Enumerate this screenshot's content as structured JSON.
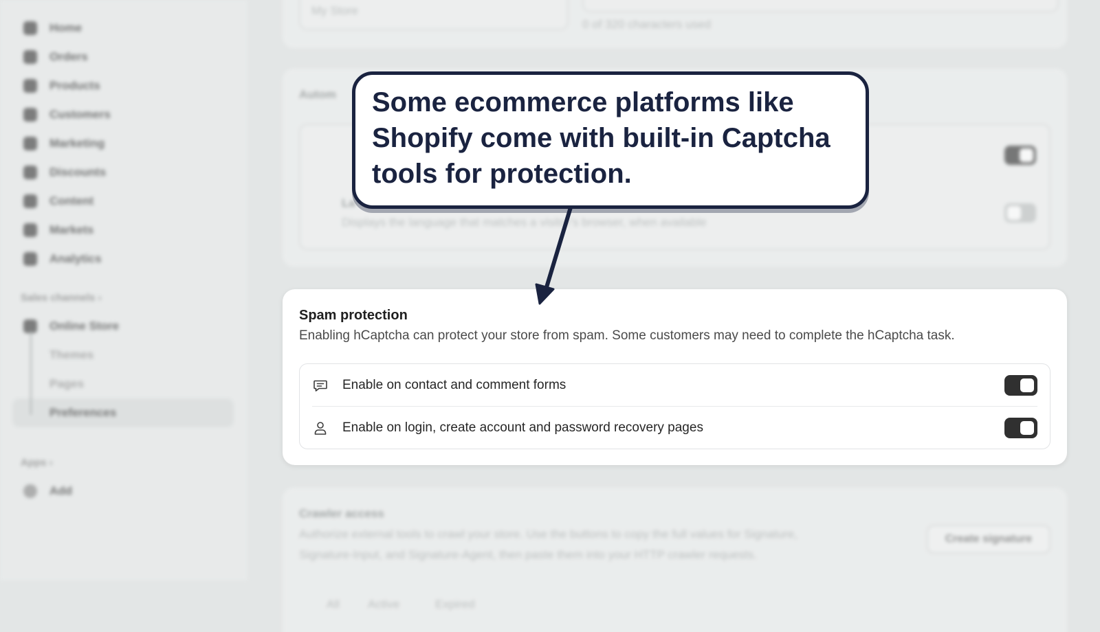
{
  "sidebar": {
    "items": [
      {
        "label": "Home",
        "icon": "home-icon"
      },
      {
        "label": "Orders",
        "icon": "inbox-icon"
      },
      {
        "label": "Products",
        "icon": "tag-icon"
      },
      {
        "label": "Customers",
        "icon": "person-icon"
      },
      {
        "label": "Marketing",
        "icon": "target-icon"
      },
      {
        "label": "Discounts",
        "icon": "discount-icon"
      },
      {
        "label": "Content",
        "icon": "content-icon"
      },
      {
        "label": "Markets",
        "icon": "globe-icon"
      },
      {
        "label": "Analytics",
        "icon": "chart-icon"
      }
    ],
    "sales_channels_label": "Sales channels",
    "online_store_label": "Online Store",
    "sub_items": [
      "Themes",
      "Pages",
      "Preferences"
    ],
    "apps_label": "Apps",
    "add_label": "Add"
  },
  "background": {
    "store_name_value": "My Store",
    "char_count": "0 of 320 characters used",
    "automatic_title": "Autom",
    "language_row_title": "La",
    "language_row_desc": "Displays the language that matches a visitor's browser, when available",
    "crawler_title": "Crawler access",
    "crawler_desc_line1": "Authorize external tools to crawl your store. Use the buttons to copy the full values for Signature,",
    "crawler_desc_line2": "Signature-Input, and Signature-Agent, then paste them into your HTTP crawler requests.",
    "create_signature_label": "Create signature",
    "filter_tabs": [
      "All",
      "Active",
      "Expired"
    ]
  },
  "spam": {
    "title": "Spam protection",
    "description": "Enabling hCaptcha can protect your store from spam. Some customers may need to complete the hCaptcha task.",
    "options": [
      {
        "label": "Enable on contact and comment forms",
        "icon": "comment-icon",
        "enabled": true
      },
      {
        "label": "Enable on login, create account and password recovery pages",
        "icon": "user-icon",
        "enabled": true
      }
    ]
  },
  "callout": {
    "text": "Some ecommerce platforms like Shopify come with built-in Captcha tools for protection."
  },
  "colors": {
    "callout_border": "#1a2340",
    "toggle_on": "#303030"
  }
}
